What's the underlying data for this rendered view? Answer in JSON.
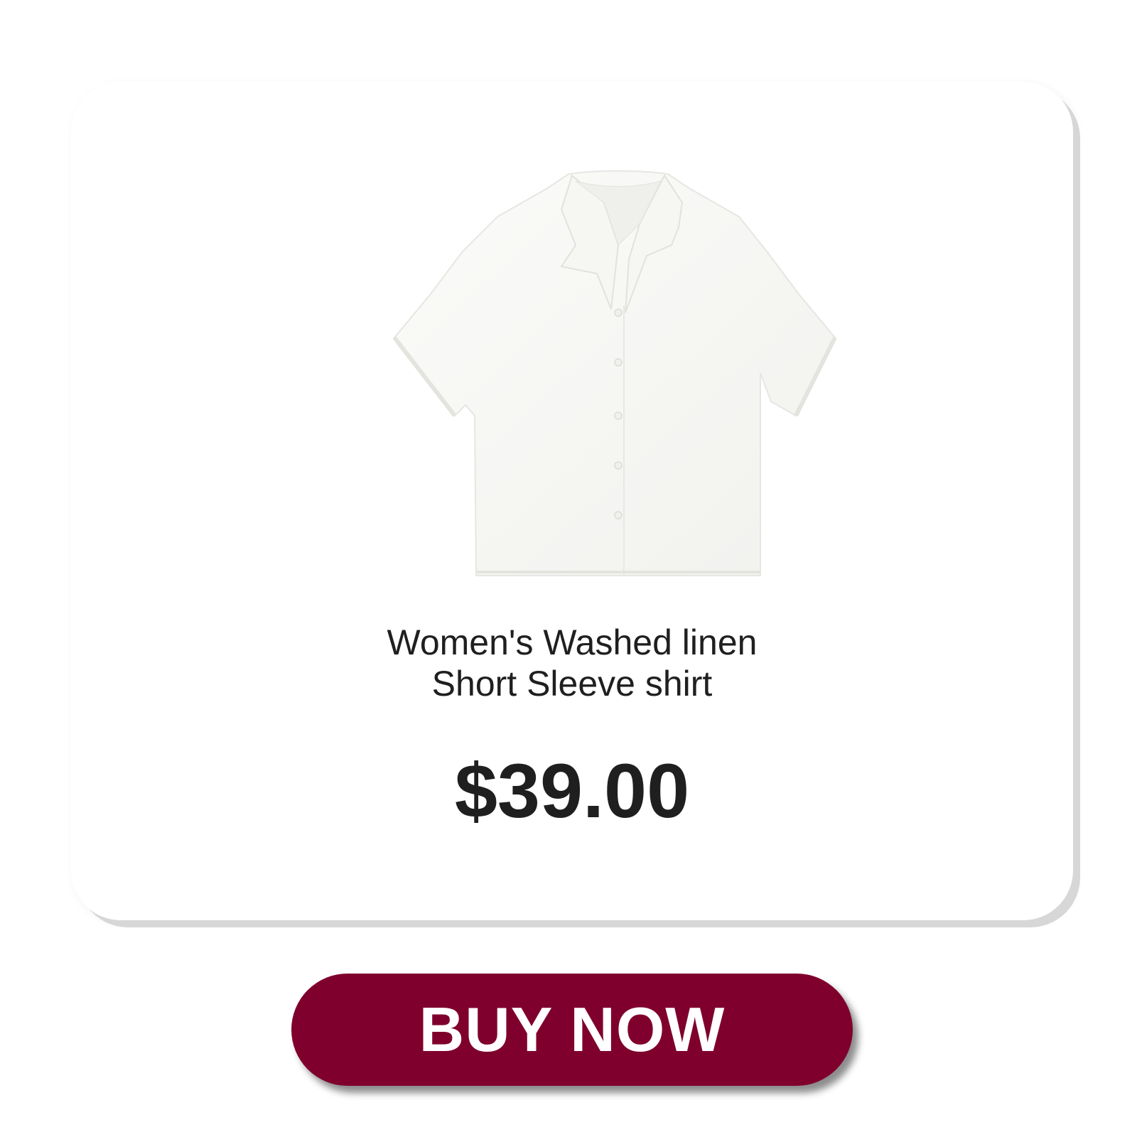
{
  "product": {
    "title_line1": "Women's Washed linen",
    "title_line2": "Short Sleeve shirt",
    "price": "$39.00",
    "image": "white-linen-short-sleeve-shirt"
  },
  "cta": {
    "label": "BUY NOW",
    "color": "#7f002c"
  },
  "colors": {
    "text": "#1f1f1f",
    "card_shadow": "#d7d7d7"
  }
}
